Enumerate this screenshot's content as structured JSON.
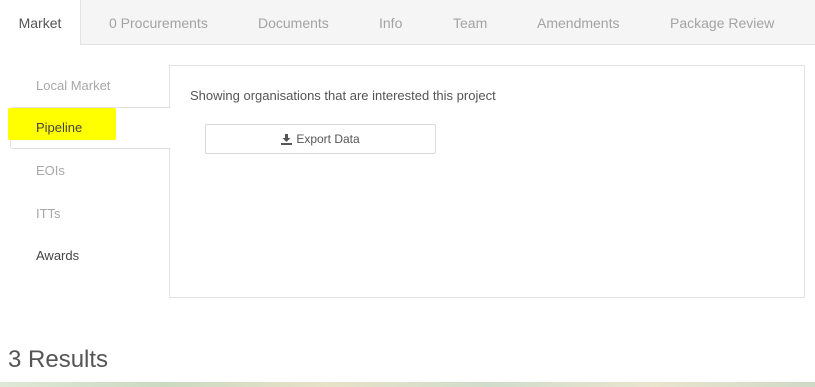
{
  "tabs": [
    {
      "label": "Market",
      "active": true
    },
    {
      "label": "0 Procurements",
      "active": false
    },
    {
      "label": "Documents",
      "active": false
    },
    {
      "label": "Info",
      "active": false
    },
    {
      "label": "Team",
      "active": false
    },
    {
      "label": "Amendments",
      "active": false
    },
    {
      "label": "Package Review",
      "active": false
    }
  ],
  "sidebar": {
    "items": [
      {
        "label": "Local Market",
        "active": false
      },
      {
        "label": "Pipeline",
        "active": true,
        "highlighted": true
      },
      {
        "label": "EOIs",
        "active": false
      },
      {
        "label": "ITTs",
        "active": false
      },
      {
        "label": "Awards",
        "active": false
      }
    ]
  },
  "panel": {
    "description": "Showing organisations that are interested this project",
    "export_label": "Export Data",
    "export_icon": "download-icon"
  },
  "results": {
    "label": "3 Results"
  },
  "colors": {
    "highlight": "#ffff00",
    "tab_bar": "#f5f5f5",
    "border": "#e2e2e2"
  }
}
